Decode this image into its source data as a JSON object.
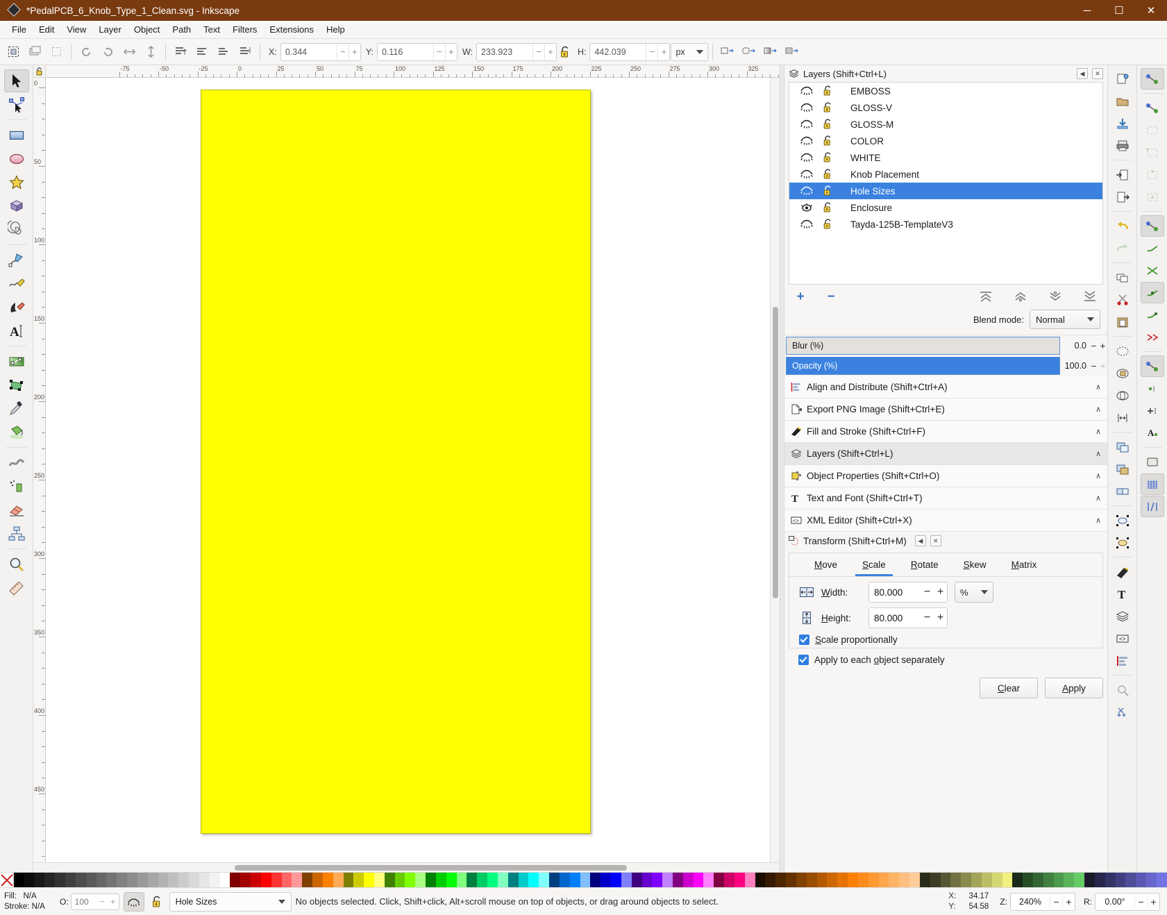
{
  "window": {
    "title": "*PedalPCB_6_Knob_Type_1_Clean.svg - Inkscape",
    "minimize_label": "─",
    "maximize_label": "☐",
    "close_label": "✕",
    "titlebar_color": "#7a3a10"
  },
  "menu": {
    "items": [
      {
        "label": "File"
      },
      {
        "label": "Edit"
      },
      {
        "label": "View"
      },
      {
        "label": "Layer"
      },
      {
        "label": "Object"
      },
      {
        "label": "Path"
      },
      {
        "label": "Text"
      },
      {
        "label": "Filters"
      },
      {
        "label": "Extensions"
      },
      {
        "label": "Help"
      }
    ]
  },
  "toolcontrol": {
    "x_label": "X:",
    "x_value": "0.344",
    "y_label": "Y:",
    "y_value": "0.116",
    "w_label": "W:",
    "w_value": "233.923",
    "h_label": "H:",
    "h_value": "442.039",
    "unit": "px",
    "minus": "−",
    "plus": "+"
  },
  "toolbox": {
    "tools": [
      {
        "name": "selector-tool",
        "active": true
      },
      {
        "name": "node-tool",
        "active": false
      },
      {
        "name": "rectangle-tool",
        "active": false
      },
      {
        "name": "ellipse-tool",
        "active": false
      },
      {
        "name": "star-tool",
        "active": false
      },
      {
        "name": "3dbox-tool",
        "active": false
      },
      {
        "name": "spiral-tool",
        "active": false
      },
      {
        "name": "bezier-tool",
        "active": false
      },
      {
        "name": "pencil-tool",
        "active": false
      },
      {
        "name": "calligraphy-tool",
        "active": false
      },
      {
        "name": "text-tool",
        "active": false
      },
      {
        "name": "gradient-tool",
        "active": false
      },
      {
        "name": "mesh-gradient-tool",
        "active": false
      },
      {
        "name": "dropper-tool",
        "active": false
      },
      {
        "name": "paint-bucket-tool",
        "active": false
      },
      {
        "name": "tweak-tool",
        "active": false
      },
      {
        "name": "spray-tool",
        "active": false
      },
      {
        "name": "eraser-tool",
        "active": false
      },
      {
        "name": "connector-tool",
        "active": false
      },
      {
        "name": "zoom-tool",
        "active": false
      },
      {
        "name": "measure-tool",
        "active": false
      }
    ]
  },
  "rulers": {
    "h_labels": [
      "-75",
      "-50",
      "-25",
      "0",
      "25",
      "50",
      "75",
      "100",
      "125",
      "150",
      "175",
      "200",
      "225",
      "250",
      "275",
      "300",
      "325"
    ],
    "v_labels": [
      "0",
      "50",
      "100",
      "150",
      "200",
      "250",
      "300",
      "350",
      "400",
      "450"
    ],
    "unit": "px"
  },
  "canvas": {
    "page_fill": "#FFFF00",
    "page_border": "#b8b800"
  },
  "layers_dialog": {
    "title": "Layers (Shift+Ctrl+L)",
    "layers": [
      {
        "name": "EMBOSS",
        "visible": false,
        "locked": false,
        "selected": false
      },
      {
        "name": "GLOSS-V",
        "visible": false,
        "locked": false,
        "selected": false
      },
      {
        "name": "GLOSS-M",
        "visible": false,
        "locked": false,
        "selected": false
      },
      {
        "name": "COLOR",
        "visible": false,
        "locked": false,
        "selected": false
      },
      {
        "name": "WHITE",
        "visible": false,
        "locked": false,
        "selected": false
      },
      {
        "name": "Knob Placement",
        "visible": false,
        "locked": false,
        "selected": false
      },
      {
        "name": "Hole Sizes",
        "visible": false,
        "locked": false,
        "selected": true
      },
      {
        "name": "Enclosure",
        "visible": true,
        "locked": false,
        "selected": false
      },
      {
        "name": "Tayda-125B-TemplateV3",
        "visible": false,
        "locked": false,
        "selected": false
      }
    ],
    "add_layer_label": "+",
    "remove_layer_label": "−",
    "blend_mode_label": "Blend mode:",
    "blend_mode_value": "Normal",
    "blur_label": "Blur (%)",
    "blur_value": "0.0",
    "blur_fill_percent": 0,
    "opacity_label": "Opacity (%)",
    "opacity_value": "100.0",
    "opacity_fill_percent": 100,
    "selected_color": "#3b82e0"
  },
  "dock_accordion": {
    "items": [
      {
        "label": "Align and Distribute (Shift+Ctrl+A)",
        "icon": "align-icon",
        "current": false
      },
      {
        "label": "Export PNG Image (Shift+Ctrl+E)",
        "icon": "export-png-icon",
        "current": false
      },
      {
        "label": "Fill and Stroke (Shift+Ctrl+F)",
        "icon": "fill-stroke-icon",
        "current": false
      },
      {
        "label": "Layers (Shift+Ctrl+L)",
        "icon": "layers-icon",
        "current": true
      },
      {
        "label": "Object Properties (Shift+Ctrl+O)",
        "icon": "object-properties-icon",
        "current": false
      },
      {
        "label": "Text and Font (Shift+Ctrl+T)",
        "icon": "text-font-icon",
        "current": false
      },
      {
        "label": "XML Editor (Shift+Ctrl+X)",
        "icon": "xml-editor-icon",
        "current": false
      }
    ],
    "chevron": "∧"
  },
  "transform_dialog": {
    "title": "Transform (Shift+Ctrl+M)",
    "tabs": [
      {
        "label": "Move",
        "active": false
      },
      {
        "label": "Scale",
        "active": true
      },
      {
        "label": "Rotate",
        "active": false
      },
      {
        "label": "Skew",
        "active": false
      },
      {
        "label": "Matrix",
        "active": false
      }
    ],
    "width_label": "Width:",
    "width_value": "80.000",
    "height_label": "Height:",
    "height_value": "80.000",
    "unit_value": "%",
    "scale_proportionally_label": "Scale proportionally",
    "scale_proportionally_checked": true,
    "apply_each_label": "Apply to each object separately",
    "apply_each_checked": true,
    "clear_button": "Clear",
    "apply_button": "Apply",
    "minus": "−",
    "plus": "+"
  },
  "statusbar": {
    "fill_label": "Fill:",
    "fill_value": "N/A",
    "stroke_label": "Stroke:",
    "stroke_value": "N/A",
    "opacity_label": "O:",
    "opacity_value": "100",
    "current_layer": "Hole Sizes",
    "message": "No objects selected. Click, Shift+click, Alt+scroll mouse on top of objects, or drag around objects to select.",
    "x_label": "X:",
    "x_value": "34.17",
    "y_label": "Y:",
    "y_value": "54.58",
    "zoom_label": "Z:",
    "zoom_value": "240%",
    "rotation_label": "R:",
    "rotation_value": "0.00°",
    "minus": "−",
    "plus": "+"
  },
  "palette": {
    "swatches": [
      "#000000",
      "#0d0d0d",
      "#1a1a1a",
      "#262626",
      "#333333",
      "#404040",
      "#4d4d4d",
      "#595959",
      "#666666",
      "#737373",
      "#808080",
      "#8c8c8c",
      "#999999",
      "#a6a6a6",
      "#b3b3b3",
      "#bfbfbf",
      "#cccccc",
      "#d9d9d9",
      "#e6e6e6",
      "#f2f2f2",
      "#ffffff",
      "#800000",
      "#a30000",
      "#cc0000",
      "#ff0000",
      "#ff3333",
      "#ff6666",
      "#ff9999",
      "#804000",
      "#cc6600",
      "#ff8000",
      "#ffaa55",
      "#808000",
      "#cccc00",
      "#ffff00",
      "#ffff80",
      "#408000",
      "#66cc00",
      "#80ff00",
      "#aaff80",
      "#008000",
      "#00cc00",
      "#00ff00",
      "#80ff80",
      "#008040",
      "#00cc66",
      "#00ff80",
      "#80ffc0",
      "#008080",
      "#00cccc",
      "#00ffff",
      "#80ffff",
      "#004080",
      "#0066cc",
      "#0080ff",
      "#80c0ff",
      "#000080",
      "#0000cc",
      "#0000ff",
      "#8080ff",
      "#400080",
      "#6600cc",
      "#8000ff",
      "#c080ff",
      "#800080",
      "#cc00cc",
      "#ff00ff",
      "#ff80ff",
      "#800040",
      "#cc0066",
      "#ff0080",
      "#ff80c0",
      "#1a0d00",
      "#331a00",
      "#4d2600",
      "#663300",
      "#804000",
      "#994d00",
      "#b35900",
      "#cc6600",
      "#e67300",
      "#ff8000",
      "#ff8c1a",
      "#ff9933",
      "#ffa64d",
      "#ffb366",
      "#ffbf80",
      "#ffcc99",
      "#2b2b1a",
      "#3d3d26",
      "#565633",
      "#707040",
      "#8a8a4d",
      "#a3a359",
      "#bdbd66",
      "#d6d673",
      "#f0f080",
      "#1a2b1a",
      "#264d26",
      "#336633",
      "#408040",
      "#4d994d",
      "#59b359",
      "#66cc66",
      "#1a1a2b",
      "#26264d",
      "#333366",
      "#404080",
      "#4d4d99",
      "#5959b3",
      "#6666cc",
      "#7373e6"
    ],
    "none_label": "X"
  },
  "snap_toolbar": {
    "buttons": [
      {
        "name": "enable-snapping",
        "on": true
      },
      {
        "name": "snap-bounding-box",
        "on": false
      },
      {
        "name": "snap-bbox-edges",
        "on": false
      },
      {
        "name": "snap-bbox-corners",
        "on": false
      },
      {
        "name": "snap-bbox-edge-midpoints",
        "on": false
      },
      {
        "name": "snap-bbox-centers",
        "on": false
      },
      {
        "name": "snap-nodes-paths",
        "on": true
      },
      {
        "name": "snap-paths",
        "on": false
      },
      {
        "name": "snap-path-intersections",
        "on": false
      },
      {
        "name": "snap-cusp-nodes",
        "on": true
      },
      {
        "name": "snap-smooth-nodes",
        "on": false
      },
      {
        "name": "snap-midpoints-line-segments",
        "on": false
      },
      {
        "name": "snap-others",
        "on": true
      },
      {
        "name": "snap-object-centers",
        "on": false
      },
      {
        "name": "snap-rotation-centers",
        "on": false
      },
      {
        "name": "snap-text-baselines",
        "on": false
      },
      {
        "name": "snap-page-border",
        "on": false
      },
      {
        "name": "snap-grids",
        "on": true
      },
      {
        "name": "snap-guides",
        "on": true
      }
    ]
  },
  "command_toolbar": {
    "buttons": [
      {
        "name": "new-document"
      },
      {
        "name": "open-document"
      },
      {
        "name": "save-document"
      },
      {
        "name": "print-document"
      },
      {
        "name": "import-file"
      },
      {
        "name": "export-file"
      },
      {
        "name": "undo"
      },
      {
        "name": "redo"
      },
      {
        "name": "copy"
      },
      {
        "name": "cut"
      },
      {
        "name": "paste"
      },
      {
        "name": "zoom-selection"
      },
      {
        "name": "zoom-drawing"
      },
      {
        "name": "zoom-page"
      },
      {
        "name": "zoom-width"
      },
      {
        "name": "duplicate"
      },
      {
        "name": "group"
      },
      {
        "name": "ungroup"
      },
      {
        "name": "object-transform"
      },
      {
        "name": "object-align"
      },
      {
        "name": "fill-and-stroke"
      },
      {
        "name": "text-and-font"
      },
      {
        "name": "layers"
      },
      {
        "name": "xml-editor"
      },
      {
        "name": "align-distribute"
      },
      {
        "name": "preferences"
      },
      {
        "name": "document-properties"
      }
    ]
  }
}
